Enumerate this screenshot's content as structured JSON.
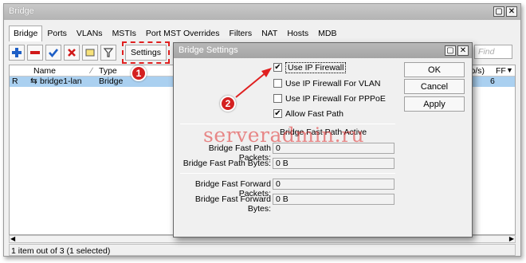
{
  "window": {
    "title": "Bridge",
    "buttons": [
      "▢",
      "✕"
    ]
  },
  "tabs": [
    "Bridge",
    "Ports",
    "VLANs",
    "MSTIs",
    "Port MST Overrides",
    "Filters",
    "NAT",
    "Hosts",
    "MDB"
  ],
  "toolbar": {
    "settings_label": "Settings",
    "find_placeholder": "Find"
  },
  "table": {
    "columns": {
      "name": "Name",
      "type": "Type",
      "tx": "(p/s)",
      "ff": "FF"
    },
    "rows": [
      {
        "flag": "R",
        "name": "bridge1-lan",
        "type": "Bridge",
        "tx": "6"
      }
    ]
  },
  "status": "1 item out of 3 (1 selected)",
  "dialog": {
    "title": "Bridge Settings",
    "buttons": {
      "ok": "OK",
      "cancel": "Cancel",
      "apply": "Apply"
    },
    "checkboxes": [
      {
        "label": "Use IP Firewall",
        "checked": true
      },
      {
        "label": "Use IP Firewall For VLAN",
        "checked": false
      },
      {
        "label": "Use IP Firewall For PPPoE",
        "checked": false
      },
      {
        "label": "Allow Fast Path",
        "checked": true
      }
    ],
    "fast_path_active": "Bridge Fast Path Active",
    "fields": [
      {
        "label": "Bridge Fast Path Packets:",
        "value": "0"
      },
      {
        "label": "Bridge Fast Path Bytes:",
        "value": "0 B"
      },
      {
        "label": "Bridge Fast Forward Packets:",
        "value": "0"
      },
      {
        "label": "Bridge Fast Forward Bytes:",
        "value": "0 B"
      }
    ]
  },
  "callouts": [
    "1",
    "2"
  ],
  "watermark": "serveradmin.ru",
  "colors": {
    "callout": "#d42020",
    "selection": "#aad0f0",
    "checkmark": "#000000"
  }
}
